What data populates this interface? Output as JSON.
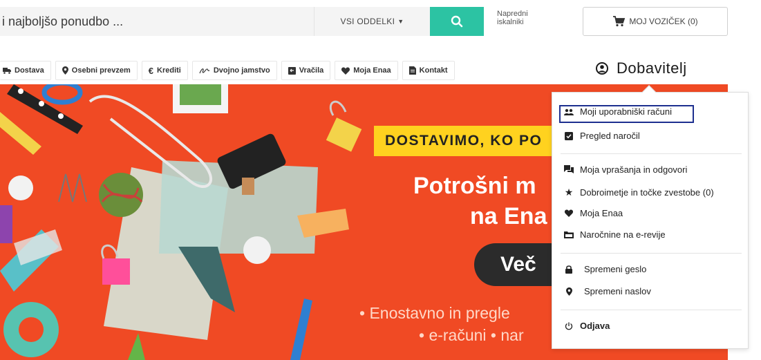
{
  "header": {
    "search_placeholder": "i najboljšo ponudbo ...",
    "dept_label": "VSI ODDELKI",
    "advanced_line1": "Napredni",
    "advanced_line2": "iskalniki",
    "cart_label": "MOJ VOZIČEK (0)"
  },
  "nav": {
    "items": [
      {
        "label": "Dostava",
        "icon": "truck-icon"
      },
      {
        "label": "Osebni prevzem",
        "icon": "map-pin-icon"
      },
      {
        "label": "Krediti",
        "icon": "euro-icon"
      },
      {
        "label": "Dvojno jamstvo",
        "icon": "signature-icon"
      },
      {
        "label": "Vračila",
        "icon": "return-box-icon"
      },
      {
        "label": "Moja Enaa",
        "icon": "heart-icon"
      },
      {
        "label": "Kontakt",
        "icon": "document-icon"
      }
    ],
    "supplier_label": "Dobavitelj"
  },
  "hero": {
    "tag": "DOSTAVIMO, KO PO",
    "line1": "Potrošni m",
    "line2": "na Ena",
    "button": "Več",
    "bottom1": "• Enostavno in pregle",
    "bottom2": "• e-računi • nar"
  },
  "dropdown": {
    "items": [
      {
        "label": "Moji uporabniški računi",
        "icon": "users-icon"
      },
      {
        "label": "Pregled naročil",
        "icon": "clipboard-check-icon"
      },
      {
        "label": "Moja vprašanja in odgovori",
        "icon": "comments-icon"
      },
      {
        "label": "Dobroimetje in točke zvestobe (0)",
        "icon": "star-icon"
      },
      {
        "label": "Moja Enaa",
        "icon": "heart-icon"
      },
      {
        "label": "Naročnine na e-revije",
        "icon": "folder-icon"
      },
      {
        "label": "Spremeni geslo",
        "icon": "lock-icon"
      },
      {
        "label": "Spremeni naslov",
        "icon": "map-pin-icon"
      },
      {
        "label": "Odjava",
        "icon": "power-icon"
      }
    ]
  },
  "colors": {
    "accent": "#2cc3a3",
    "hero_bg": "#f04a24",
    "highlight": "#1d2f8f",
    "tag_yellow": "#ffd21f"
  }
}
